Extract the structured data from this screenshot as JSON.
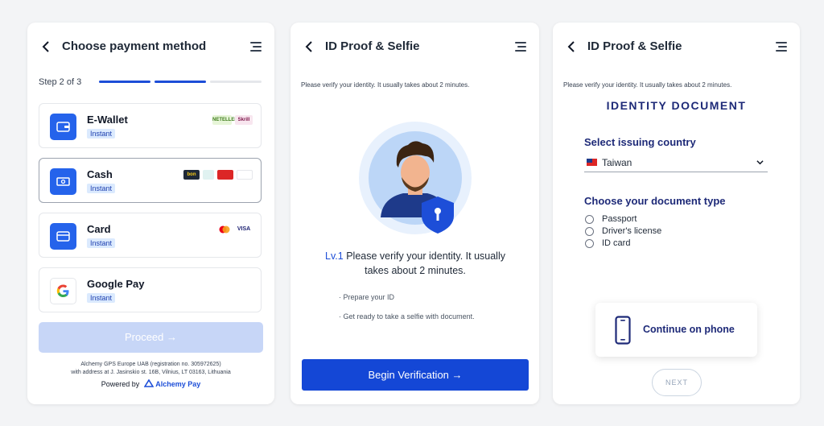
{
  "screens": {
    "payment": {
      "title": "Choose payment method",
      "step": "Step 2 of 3",
      "progress": {
        "current": 2,
        "total": 3
      },
      "methods": [
        {
          "name": "E-Wallet",
          "badge": "Instant",
          "logos": [
            "NETELLER",
            "Skrill"
          ]
        },
        {
          "name": "Cash",
          "badge": "Instant",
          "logos": [
            "bon",
            "",
            "",
            ""
          ]
        },
        {
          "name": "Card",
          "badge": "Instant",
          "logos": [
            "",
            "VISA"
          ]
        },
        {
          "name": "Google Pay",
          "badge": "Instant",
          "logos": []
        }
      ],
      "proceed": "Proceed →",
      "legal_line1": "Alchemy GPS Europe UAB (registration no. 305972625)",
      "legal_line2": "with address at J. Jasinskio st. 16B, Vilnius, LT 03163, Lithuania",
      "powered_by": "Powered by",
      "brand": "Alchemy Pay"
    },
    "id_intro": {
      "title": "ID Proof & Selfie",
      "intro": "Please verify your identity. It usually takes about 2 minutes.",
      "level": "Lv.1",
      "level_text": "Please verify your identity. It usually takes about 2 minutes.",
      "bullets": [
        "Prepare your ID",
        "Get ready to take a selfie with document."
      ],
      "begin": "Begin Verification →"
    },
    "id_document": {
      "title": "ID Proof & Selfie",
      "intro": "Please verify your identity. It usually takes about 2 minutes.",
      "heading": "IDENTITY DOCUMENT",
      "country_label": "Select issuing country",
      "country_value": "Taiwan",
      "doc_type_label": "Choose your document type",
      "doc_types": [
        "Passport",
        "Driver's license",
        "ID card"
      ],
      "continue_phone": "Continue on phone",
      "next": "NEXT"
    }
  },
  "colors": {
    "primary": "#1447d6",
    "navy": "#1e2a78",
    "badge_bg": "#dbeafe",
    "disabled": "#c7d6f7"
  },
  "icons": [
    "back-arrow-icon",
    "menu-icon",
    "wallet-icon",
    "cash-icon",
    "card-icon",
    "google-icon",
    "shield-keyhole-icon",
    "phone-icon",
    "chevron-down-icon",
    "taiwan-flag-icon"
  ]
}
